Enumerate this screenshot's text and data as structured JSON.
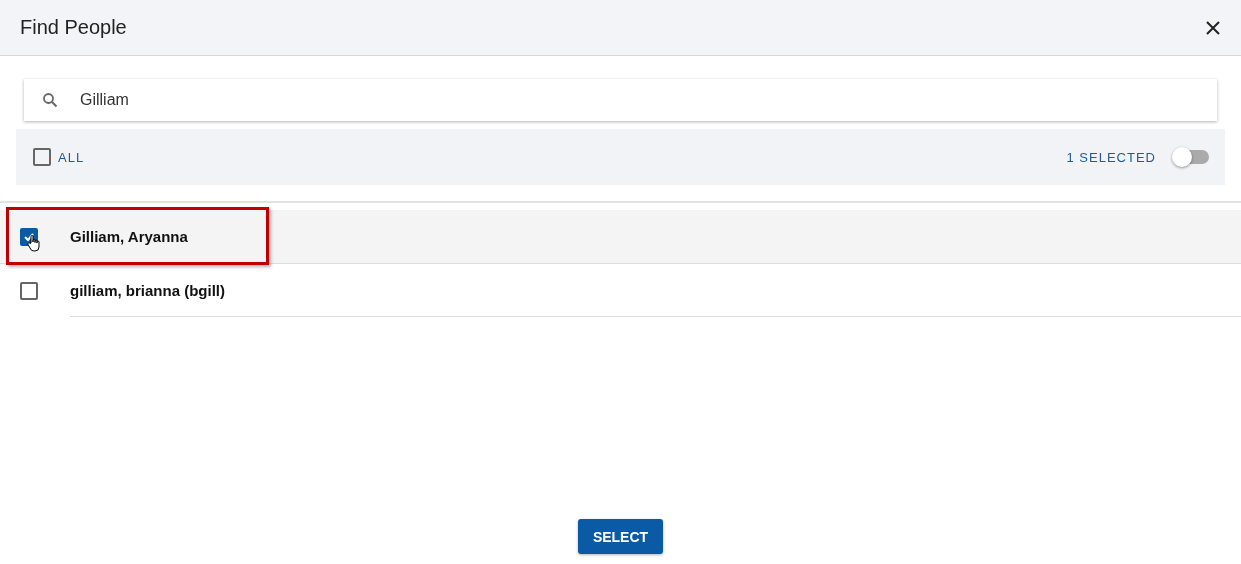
{
  "dialog": {
    "title": "Find People"
  },
  "search": {
    "value": "Gilliam"
  },
  "filter": {
    "all_label": "ALL",
    "all_checked": false,
    "selected_count": "1 SELECTED",
    "show_selected_only": false
  },
  "people": [
    {
      "name": "Gilliam, Aryanna",
      "selected": true,
      "highlighted": true
    },
    {
      "name": "gilliam, brianna (bgill)",
      "selected": false,
      "highlighted": false
    }
  ],
  "buttons": [
    {
      "label": "SELECT"
    }
  ]
}
